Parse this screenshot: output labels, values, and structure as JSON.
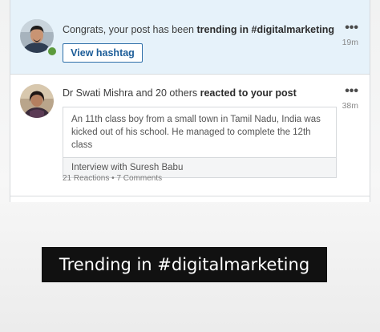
{
  "notifications": [
    {
      "text_prefix": "Congrats, your post has been ",
      "text_bold": "trending in #digitalmarketing",
      "button_label": "View hashtag",
      "time": "19m",
      "more": "•••"
    },
    {
      "text_prefix": "Dr Swati Mishra and 20 others ",
      "text_bold": "reacted to your post",
      "time": "38m",
      "more": "•••",
      "post_excerpt": "An 11th class boy from a small town in Tamil Nadu, India was kicked out of his school. He managed to complete the 12th class",
      "post_link_title": "Interview with Suresh Babu",
      "reactions": "21 Reactions",
      "separator": "•",
      "comments": "7 Comments"
    }
  ],
  "caption": "Trending in #digitalmarketing",
  "colors": {
    "highlight_bg": "#e6f2fa",
    "button_blue": "#1d5d98",
    "presence_green": "#5b9a3c",
    "caption_bg": "#111111"
  }
}
